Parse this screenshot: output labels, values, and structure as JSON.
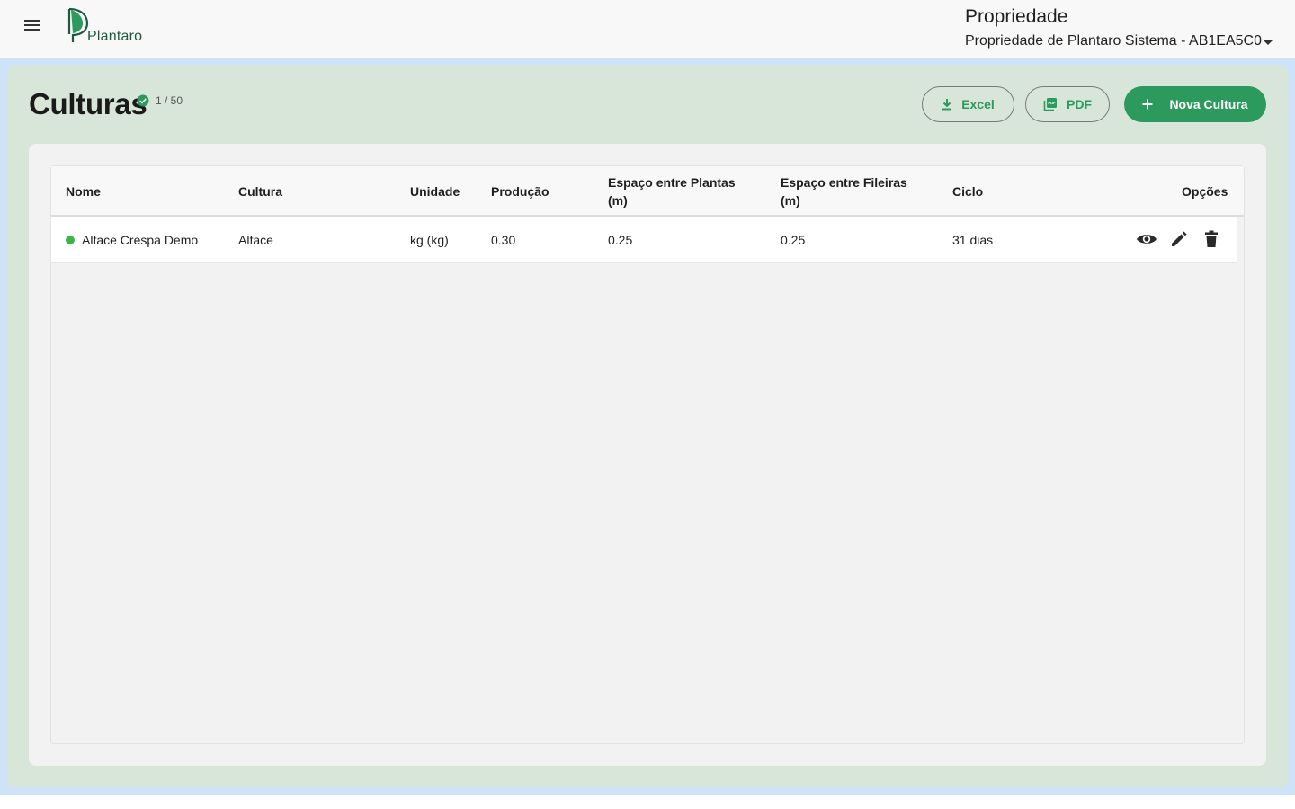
{
  "header": {
    "logo_text": "Plantaro",
    "property_label": "Propriedade",
    "property_value": "Propriedade de Plantaro Sistema - AB1EA5C0"
  },
  "page": {
    "title": "Culturas",
    "counter": "1 / 50"
  },
  "toolbar": {
    "excel_label": "Excel",
    "pdf_label": "PDF",
    "new_label": "Nova Cultura"
  },
  "table": {
    "columns": {
      "nome": "Nome",
      "cultura": "Cultura",
      "unidade": "Unidade",
      "producao": "Produção",
      "espaco_plantas_1": "Espaço entre Plantas",
      "espaco_plantas_2": "(m)",
      "espaco_fileiras_1": "Espaço entre Fileiras",
      "espaco_fileiras_2": "(m)",
      "ciclo": "Ciclo",
      "opcoes": "Opções"
    },
    "rows": [
      {
        "status": "active",
        "nome": "Alface Crespa Demo",
        "cultura": "Alface",
        "unidade": "kg (kg)",
        "producao": "0.30",
        "espaco_plantas": "0.25",
        "espaco_fileiras": "0.25",
        "ciclo": "31 dias"
      }
    ]
  },
  "colors": {
    "accent": "#2c9a5c",
    "status_active": "#3bb54a",
    "panel_bg": "#d8e6da",
    "band_bg": "#cfe3f8"
  },
  "icons": {
    "menu": "menu-icon",
    "check": "check-circle-icon",
    "download": "download-icon",
    "pdf": "pdf-icon",
    "add": "plus-icon",
    "view": "eye-icon",
    "edit": "pencil-icon",
    "delete": "trash-icon",
    "dropdown": "chevron-down-icon"
  }
}
